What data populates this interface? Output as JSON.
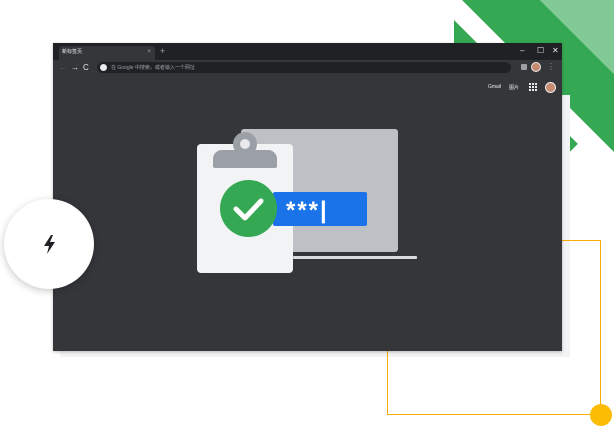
{
  "colors": {
    "green": "#34a853",
    "light_green": "#81c995",
    "yellow": "#fbbc04",
    "blue": "#1a73e8",
    "dark_bg": "#35363a",
    "tabbar_bg": "#202124"
  },
  "browser": {
    "tab": {
      "title": "新标签页",
      "close_label": "×"
    },
    "new_tab_label": "+",
    "window_controls": {
      "minimize": "–",
      "maximize": "☐",
      "close": "✕"
    },
    "toolbar": {
      "back": "←",
      "forward": "→",
      "reload": "C",
      "menu": "⋮"
    },
    "omnibox": {
      "placeholder": "在 Google 中搜索，或者输入一个网址"
    },
    "header_links": {
      "gmail": "Gmail",
      "images": "图片"
    }
  },
  "illustration": {
    "password_mask": "***|",
    "check_icon": "check-icon",
    "clipboard_icon": "clipboard-icon",
    "laptop_icon": "laptop-icon"
  },
  "floating_badge": {
    "icon": "lightning-bolt-icon"
  }
}
